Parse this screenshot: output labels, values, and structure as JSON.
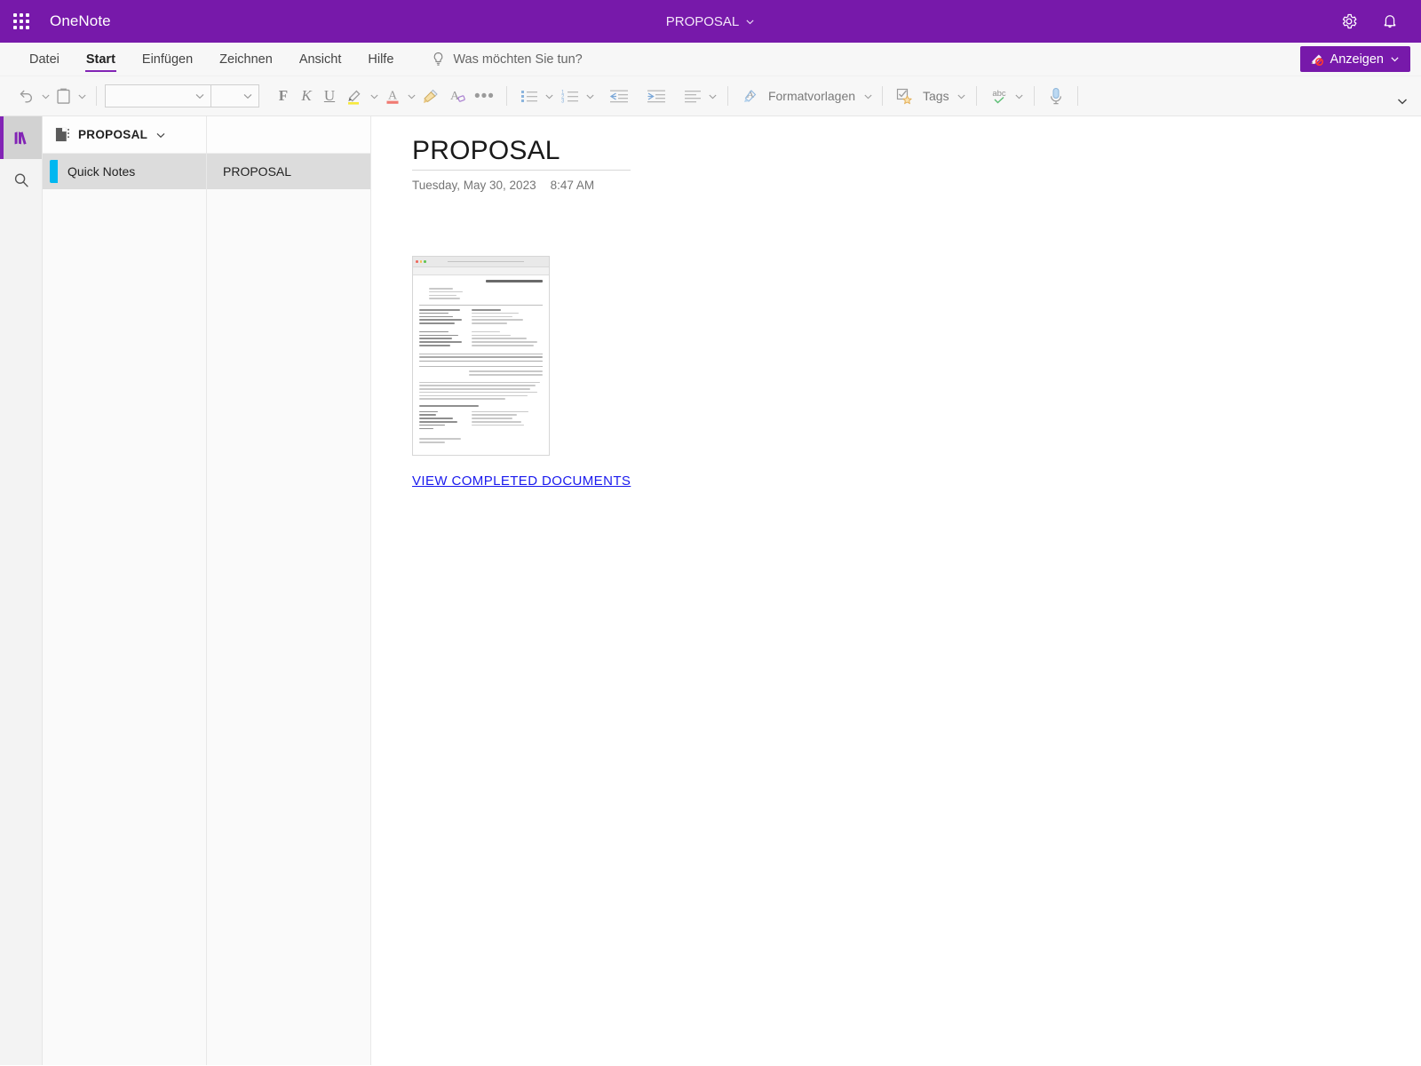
{
  "appbar": {
    "waffle_label": "app-launcher",
    "app_name": "OneNote",
    "document_name": "PROPOSAL",
    "settings_icon": "gear-icon",
    "notifications_icon": "bell-icon"
  },
  "menubar": {
    "tabs": [
      {
        "label": "Datei",
        "active": false
      },
      {
        "label": "Start",
        "active": true
      },
      {
        "label": "Einfügen",
        "active": false
      },
      {
        "label": "Zeichnen",
        "active": false
      },
      {
        "label": "Ansicht",
        "active": false
      },
      {
        "label": "Hilfe",
        "active": false
      }
    ],
    "tellme_placeholder": "Was möchten Sie tun?",
    "tellme_icon": "lightbulb-icon",
    "view_button": {
      "label": "Anzeigen",
      "icon": "pen-block-icon"
    }
  },
  "ribbon": {
    "undo_icon": "undo-icon",
    "paste_icon": "clipboard-icon",
    "font_name": "",
    "font_size": "",
    "bold_label": "F",
    "italic_label": "K",
    "underline_label": "U",
    "highlight_icon": "highlighter-icon",
    "font_color_icon": "font-color-icon",
    "format_painter_icon": "format-painter-icon",
    "clear_format_icon": "clear-formatting-icon",
    "more_label": "•••",
    "bullets_icon": "bulleted-list-icon",
    "numbering_icon": "numbered-list-icon",
    "decrease_indent_icon": "decrease-indent-icon",
    "increase_indent_icon": "increase-indent-icon",
    "align_icon": "align-icon",
    "styles_label": "Formatvorlagen",
    "styles_icon": "styles-icon",
    "tags_label": "Tags",
    "tags_icon": "tag-star-icon",
    "spelling_label": "abc",
    "spelling_icon": "spell-check-icon",
    "dictate_icon": "microphone-icon",
    "collapse_icon": "chevron-down-icon"
  },
  "rail": {
    "notebooks_icon": "notebooks-icon",
    "search_icon": "search-icon"
  },
  "sections": {
    "notebook_icon": "notebook-icon",
    "notebook_title": "PROPOSAL",
    "notebook_chevron": "chevron-down-icon",
    "items": [
      {
        "label": "Quick Notes",
        "color": "#00b7f0",
        "selected": true
      }
    ]
  },
  "pages": {
    "items": [
      {
        "label": "PROPOSAL",
        "selected": true
      }
    ]
  },
  "canvas": {
    "title": "PROPOSAL",
    "date": "Tuesday, May 30, 2023",
    "time": "8:47 AM",
    "embedded_image_name": "invoice-document-screenshot",
    "link_label": "VIEW COMPLETED DOCUMENTS",
    "link_color": "#1a1aee"
  },
  "theme": {
    "brand_purple": "#7719AA",
    "accent_purple": "#8224b5",
    "section_cyan": "#00b7f0",
    "selected_row_gray": "#dcdcdc",
    "ribbon_bg": "#f7f7f7"
  }
}
